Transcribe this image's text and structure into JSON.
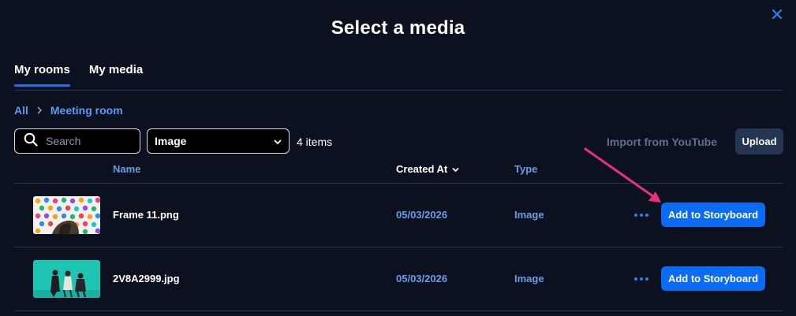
{
  "dialog": {
    "title": "Select a media"
  },
  "tabs": [
    {
      "label": "My rooms",
      "active": true
    },
    {
      "label": "My media",
      "active": false
    }
  ],
  "breadcrumb": {
    "root": "All",
    "current": "Meeting room"
  },
  "toolbar": {
    "search_placeholder": "Search",
    "filter_value": "Image",
    "count": "4 items",
    "import_label": "Import from YouTube",
    "upload_label": "Upload"
  },
  "table": {
    "columns": {
      "name": "Name",
      "created_at": "Created At",
      "type": "Type"
    },
    "rows": [
      {
        "name": "Frame 11.png",
        "created_at": "05/03/2026",
        "type": "Image",
        "action": "Add to Storyboard"
      },
      {
        "name": "2V8A2999.jpg",
        "created_at": "05/03/2026",
        "type": "Image",
        "action": "Add to Storyboard"
      }
    ]
  },
  "icons": {
    "close": "close-icon",
    "search": "search-icon",
    "chevron": "chevron-down-icon",
    "sort": "sort-down-icon",
    "more": "more-icon"
  },
  "colors": {
    "background": "#0b111f",
    "accent": "#0a6cf5",
    "link": "#5b9af5",
    "annotation": "#e8317a"
  }
}
